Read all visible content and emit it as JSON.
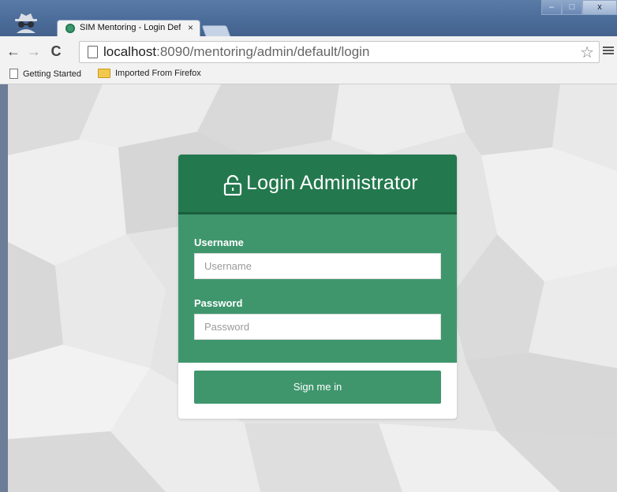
{
  "browser": {
    "tab_title": "SIM Mentoring - Login Defaul",
    "tab_close": "×",
    "url_host": "localhost",
    "url_rest": ":8090/mentoring/admin/default/login",
    "back_glyph": "←",
    "forward_glyph": "→",
    "reload_glyph": "C",
    "star_glyph": "☆",
    "win_minimize": "–",
    "win_maximize": "□",
    "win_close": "x"
  },
  "bookmarks": {
    "items": [
      {
        "label": "Getting Started",
        "icon": "page-icon"
      },
      {
        "label": "Imported From Firefox",
        "icon": "folder-icon"
      }
    ]
  },
  "login": {
    "title": "Login Administrator",
    "username_label": "Username",
    "username_placeholder": "Username",
    "password_label": "Password",
    "password_placeholder": "Password",
    "signin_label": "Sign me in",
    "colors": {
      "header": "#23784e",
      "body": "#3f966d",
      "button": "#3f966d"
    }
  }
}
